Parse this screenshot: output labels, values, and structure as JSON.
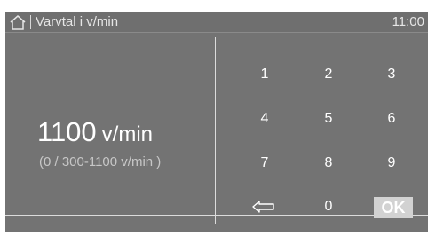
{
  "titlebar": {
    "title": "Varvtal i v/min",
    "time": "11:00",
    "home_icon": "home-icon"
  },
  "display": {
    "value": "1100",
    "unit": "v/min",
    "range": "(0 / 300-1100 v/min )"
  },
  "keypad": {
    "keys": [
      "1",
      "2",
      "3",
      "4",
      "5",
      "6",
      "7",
      "8",
      "9"
    ],
    "backspace_icon": "backspace-arrow-icon",
    "zero": "0",
    "ok": "OK"
  },
  "colors": {
    "panel": "#737373",
    "divider": "#dcdcdc",
    "ok_button": "#d2d2d2"
  }
}
